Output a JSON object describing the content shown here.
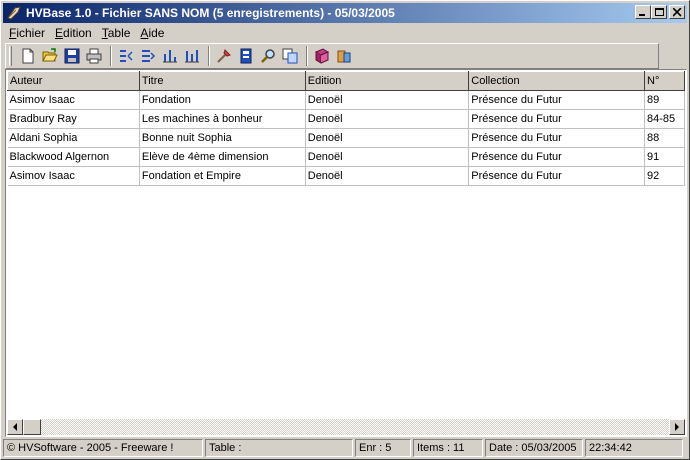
{
  "window": {
    "title": "HVBase 1.0 - Fichier SANS NOM (5 enregistrements) - 05/03/2005"
  },
  "menu": [
    {
      "first": "F",
      "rest": "ichier"
    },
    {
      "first": "E",
      "rest": "dition"
    },
    {
      "first": "T",
      "rest": "able"
    },
    {
      "first": "A",
      "rest": "ide"
    }
  ],
  "toolbar": {
    "icons": [
      "new-file-icon",
      "open-folder-icon",
      "save-icon",
      "print-icon",
      "add-record-icon",
      "insert-record-icon",
      "sort-up-icon",
      "sort-down-icon",
      "filter-icon",
      "bookmark-icon",
      "search-icon",
      "copy-icon",
      "book-icon",
      "export-icon"
    ]
  },
  "table": {
    "columns": [
      "Auteur",
      "Titre",
      "Edition",
      "Collection",
      "N°"
    ],
    "rows": [
      [
        "Asimov Isaac",
        "Fondation",
        "Denoël",
        "Présence du Futur",
        "89"
      ],
      [
        "Bradbury Ray",
        "Les machines à bonheur",
        "Denoël",
        "Présence du Futur",
        "84-85"
      ],
      [
        "Aldani Sophia",
        "Bonne nuit Sophia",
        "Denoël",
        "Présence du Futur",
        "88"
      ],
      [
        "Blackwood Algernon",
        "Elève de 4ème dimension",
        "Denoël",
        "Présence du Futur",
        "91"
      ],
      [
        "Asimov Isaac",
        "Fondation et Empire",
        "Denoël",
        "Présence du Futur",
        "92"
      ]
    ]
  },
  "status": {
    "copyright": "© HVSoftware - 2005 - Freeware !",
    "table": "Table :",
    "enr": "Enr : 5",
    "items": "Items : 11",
    "date": "Date : 05/03/2005",
    "time": "22:34:42"
  }
}
